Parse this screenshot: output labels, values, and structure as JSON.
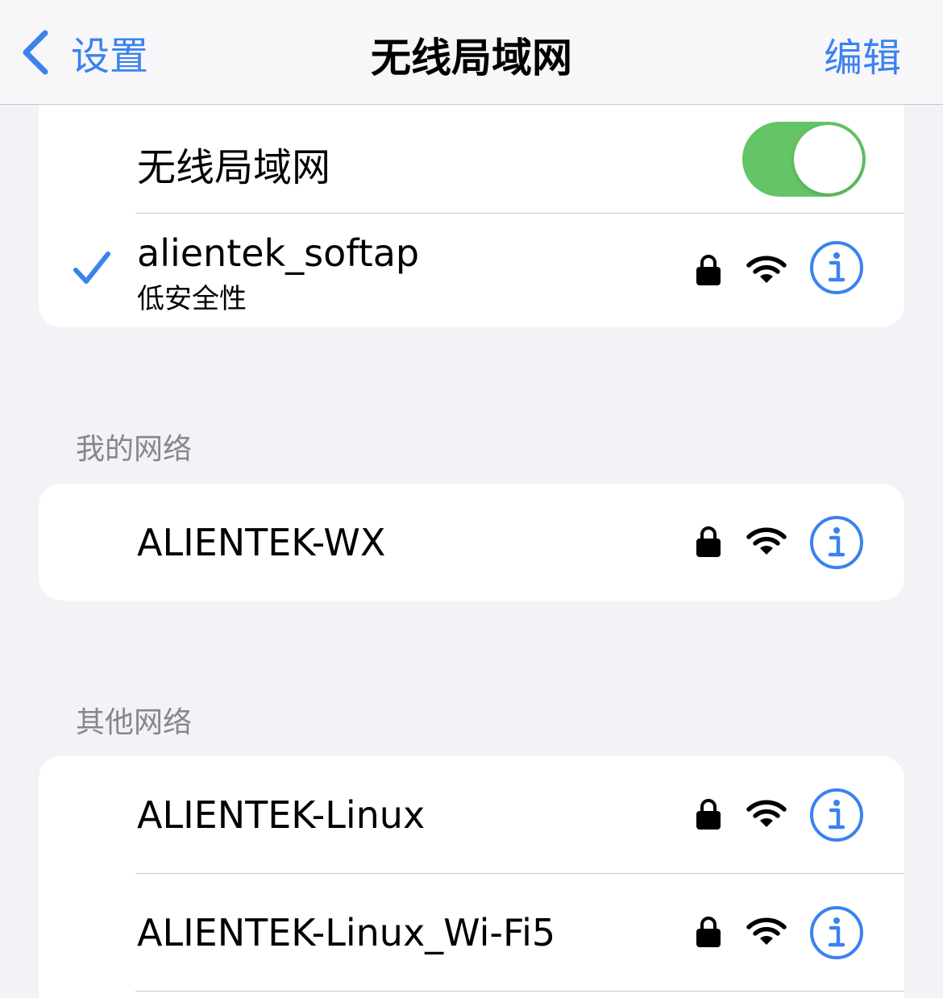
{
  "nav": {
    "back_label": "设置",
    "title": "无线局域网",
    "edit_label": "编辑"
  },
  "wifi_toggle": {
    "label": "无线局域网",
    "on": true
  },
  "connected": {
    "name": "alientek_softap",
    "subtitle": "低安全性",
    "selected": true
  },
  "my_networks": {
    "header": "我的网络",
    "items": [
      {
        "name": "ALIENTEK-WX"
      }
    ]
  },
  "other_networks": {
    "header": "其他网络",
    "items": [
      {
        "name": "ALIENTEK-Linux"
      },
      {
        "name": "ALIENTEK-Linux_Wi-Fi5"
      }
    ]
  },
  "colors": {
    "accent": "#3b82f0",
    "toggle_on": "#65c466",
    "background": "#f2f2f7",
    "section_header": "#86868b"
  },
  "icons": [
    "chevron-left-icon",
    "checkmark-icon",
    "lock-icon",
    "wifi-icon",
    "info-icon"
  ]
}
